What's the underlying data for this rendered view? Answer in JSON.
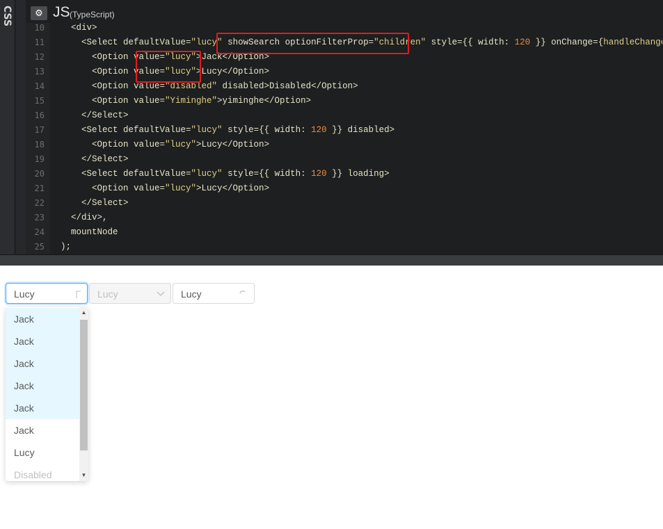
{
  "editor": {
    "side_tab": "CSS",
    "lang": "JS",
    "lang_sub": "(TypeScript)",
    "line_numbers": [
      "10",
      "11",
      "12",
      "13",
      "14",
      "15",
      "16",
      "17",
      "18",
      "19",
      "20",
      "21",
      "22",
      "23",
      "24",
      "25"
    ],
    "lines": [
      [
        "    <div>"
      ],
      [
        "      <Select defaultValue=",
        "s:\"lucy\"",
        " showSearch optionFilterProp=",
        "s:\"children\"",
        " style={{ width: ",
        "n:120",
        " }} onChange={",
        "s:handleChange",
        "}>"
      ],
      [
        "        <Option value=",
        "s:\"lucy\"",
        ">Jack</Option>"
      ],
      [
        "        <Option value=",
        "s:\"lucy\"",
        ">Lucy</Option>"
      ],
      [
        "        <Option value=",
        "s:\"disabled\"",
        " disabled>Disabled</Option>"
      ],
      [
        "        <Option value=",
        "s:\"Yiminghe\"",
        ">yiminghe</Option>"
      ],
      [
        "      </Select>"
      ],
      [
        "      <Select defaultValue=",
        "s:\"lucy\"",
        " style={{ width: ",
        "n:120",
        " }} disabled>"
      ],
      [
        "        <Option value=",
        "s:\"lucy\"",
        ">Lucy</Option>"
      ],
      [
        "      </Select>"
      ],
      [
        "      <Select defaultValue=",
        "s:\"lucy\"",
        " style={{ width: ",
        "n:120",
        " }} loading>"
      ],
      [
        "        <Option value=",
        "s:\"lucy\"",
        ">Lucy</Option>"
      ],
      [
        "      </Select>"
      ],
      [
        "    </div>,"
      ],
      [
        "    mountNode"
      ],
      [
        "  );"
      ]
    ]
  },
  "preview": {
    "select_search_value": "Lucy",
    "select_disabled_value": "Lucy",
    "select_loading_value": "Lucy",
    "options": [
      {
        "label": "Jack",
        "state": "highlighted"
      },
      {
        "label": "Jack",
        "state": "highlighted"
      },
      {
        "label": "Jack",
        "state": "highlighted"
      },
      {
        "label": "Jack",
        "state": "highlighted"
      },
      {
        "label": "Jack",
        "state": "highlighted"
      },
      {
        "label": "Jack",
        "state": "normal"
      },
      {
        "label": "Lucy",
        "state": "normal"
      },
      {
        "label": "Disabled",
        "state": "disabled"
      }
    ]
  },
  "colors": {
    "highlight_box": "#e41b1b",
    "focus_border": "#40a9ff",
    "option_highlight": "#e6f7ff"
  }
}
